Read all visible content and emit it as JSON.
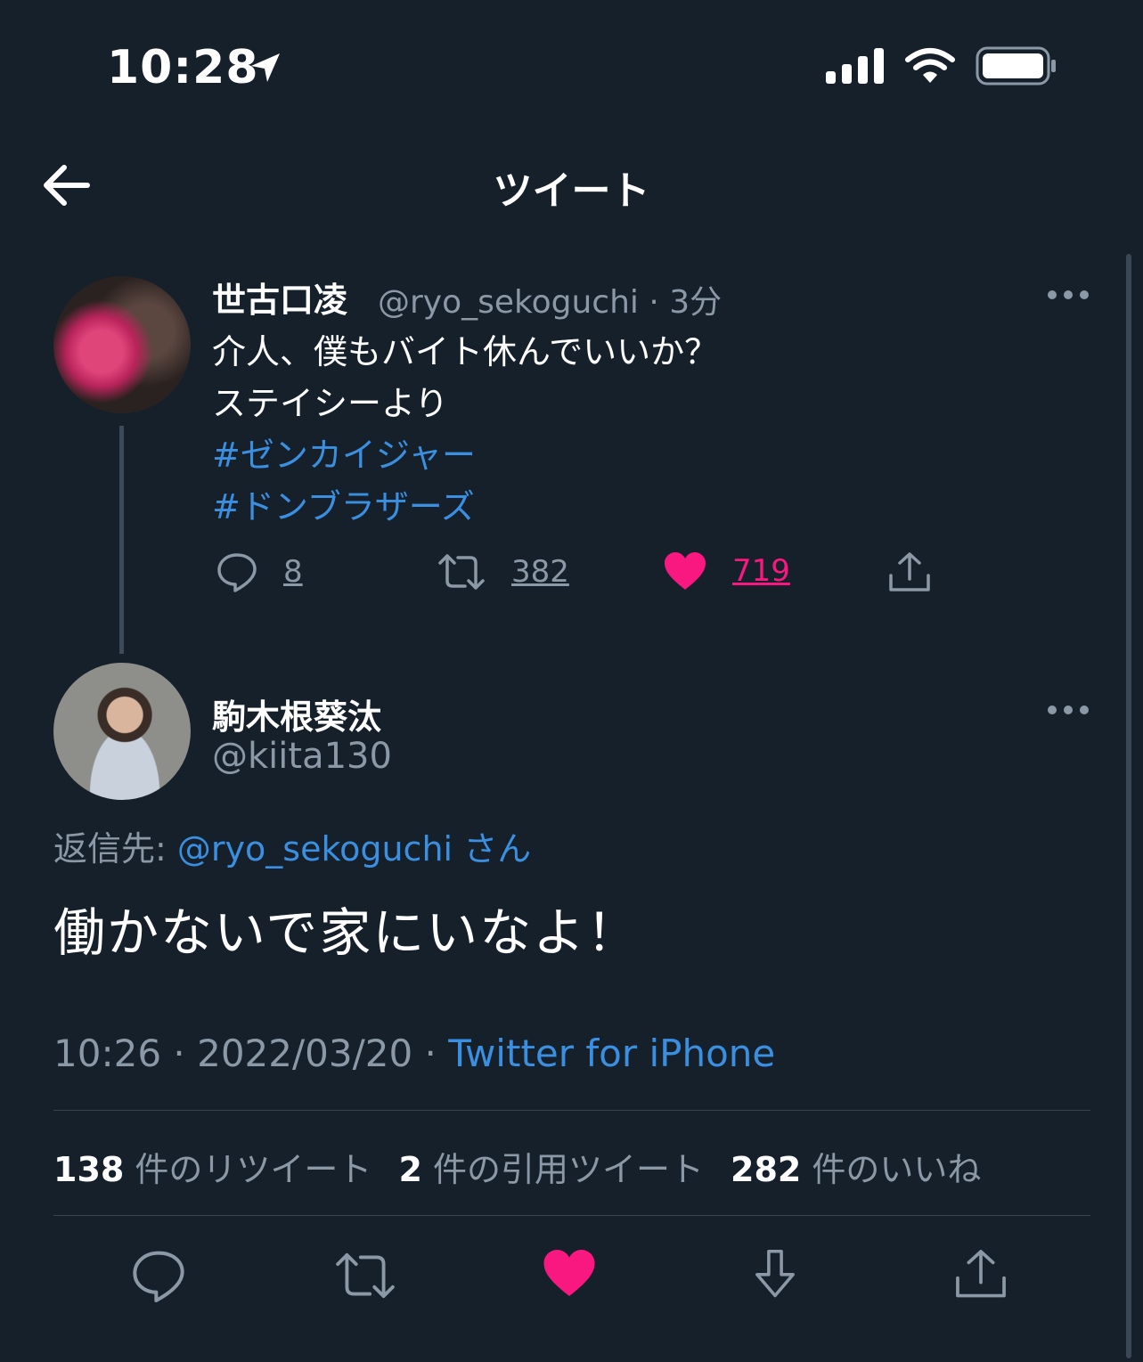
{
  "status_bar": {
    "time": "10:28",
    "icons": [
      "location-arrow-icon",
      "signal-bars-icon",
      "wifi-icon",
      "battery-icon"
    ]
  },
  "header": {
    "title": "ツイート",
    "back_icon": "arrow-left-icon"
  },
  "parent_tweet": {
    "name": "世古口凌",
    "handle": "@ryo_sekoguchi",
    "time_ago": "3分",
    "text_lines": [
      "介人、僕もバイト休んでいいか？",
      "ステイシーより"
    ],
    "hashtags": [
      "#ゼンカイジャー",
      "#ドンブラザーズ"
    ],
    "replies": "8",
    "retweets": "382",
    "likes": "719",
    "liked": true
  },
  "main_tweet": {
    "name": "駒木根葵汰",
    "handle": "@kiita130",
    "reply_label": "返信先:",
    "reply_mention": "@ryo_sekoguchi",
    "reply_suffix": "さん",
    "text": "働かないで家にいなよ！",
    "time": "10:26",
    "date": "2022/03/20",
    "source": "Twitter for iPhone",
    "stats": {
      "retweets": "138",
      "retweets_label": "件のリツイート",
      "quotes": "2",
      "quotes_label": "件の引用ツイート",
      "likes": "282",
      "likes_label": "件のいいね"
    }
  },
  "colors": {
    "background": "#15202b",
    "link": "#3b8fe0",
    "like": "#f91880",
    "secondary_text": "#8b98a5"
  }
}
